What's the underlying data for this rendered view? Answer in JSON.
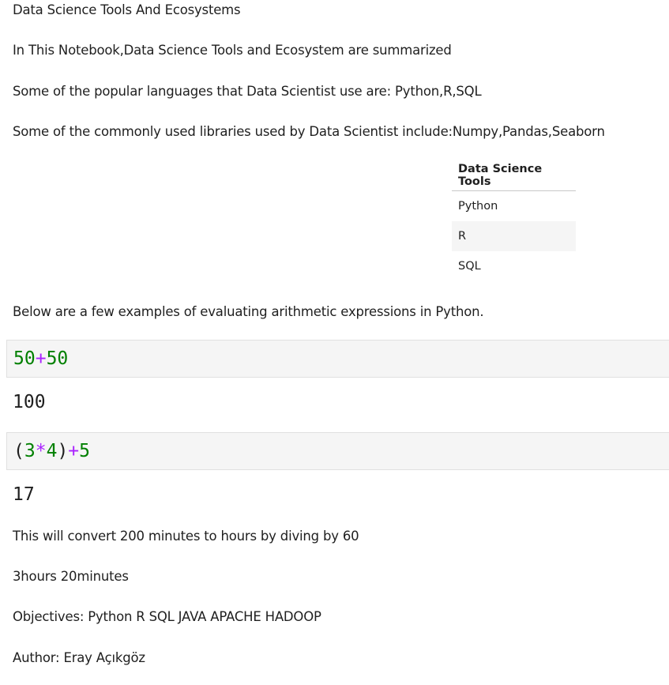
{
  "markdown": {
    "title": "Data Science Tools And Ecosystems",
    "intro": "In This Notebook,Data Science Tools and Ecosystem are summarized",
    "languages": "Some of the popular languages that Data Scientist use are: Python,R,SQL",
    "libraries": "Some of the commonly used libraries used by Data Scientist include:Numpy,Pandas,Seaborn",
    "examples_intro": "Below are a few examples of evaluating arithmetic expressions in Python.",
    "convert_note": "This will convert 200 minutes to hours by diving by 60",
    "convert_result": "3hours 20minutes",
    "objectives": "Objectives: Python R SQL JAVA APACHE HADOOP",
    "author": "Author: Eray Açıkgöz"
  },
  "tools_table": {
    "header": "Data Science Tools",
    "rows": [
      "Python",
      "R",
      "SQL"
    ]
  },
  "cells": [
    {
      "tokens": {
        "a": "50",
        "op": "+",
        "b": "50"
      },
      "output": "100"
    },
    {
      "tokens": {
        "lparen": "(",
        "a": "3",
        "mul": "*",
        "b": "4",
        "rparen": ")",
        "op": "+",
        "c": "5"
      },
      "output": "17"
    }
  ],
  "colors": {
    "number": "#008000",
    "operator": "#aa22ff",
    "code_bg": "#f5f5f5"
  }
}
